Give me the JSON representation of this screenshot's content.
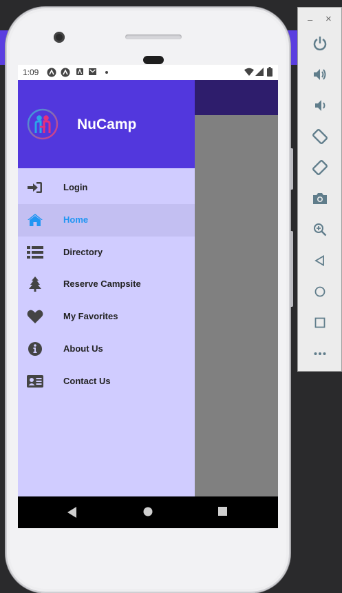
{
  "status_bar": {
    "time": "1:09",
    "notification_icons": [
      "app-icon",
      "app-icon",
      "a-badge-icon",
      "gmail-icon",
      "dot-icon"
    ],
    "system_icons": [
      "wifi-icon",
      "signal-icon",
      "battery-icon"
    ]
  },
  "drawer": {
    "app_name": "NuCamp",
    "logo": "nucamp-logo",
    "active_item": "Home",
    "active_color": "#2196f3",
    "header_color": "#5237dd",
    "background_color": "#d0ccff",
    "items": [
      {
        "label": "Login",
        "icon": "sign-in-icon"
      },
      {
        "label": "Home",
        "icon": "home-icon"
      },
      {
        "label": "Directory",
        "icon": "list-icon"
      },
      {
        "label": "Reserve Campsite",
        "icon": "tree-icon"
      },
      {
        "label": "My Favorites",
        "icon": "heart-icon"
      },
      {
        "label": "About Us",
        "icon": "info-icon"
      },
      {
        "label": "Contact Us",
        "icon": "address-card-icon"
      }
    ]
  },
  "nav_bar": {
    "buttons": [
      "back-icon",
      "home-icon",
      "recents-icon"
    ]
  },
  "emulator_toolbar": {
    "window_buttons": [
      "minimize-icon",
      "close-icon"
    ],
    "minimize_label": "–",
    "close_label": "×",
    "controls": [
      "power-icon",
      "volume-up-icon",
      "volume-down-icon",
      "rotate-left-icon",
      "rotate-right-icon",
      "camera-icon",
      "zoom-icon",
      "back-icon",
      "home-icon",
      "overview-icon",
      "more-icon"
    ]
  }
}
